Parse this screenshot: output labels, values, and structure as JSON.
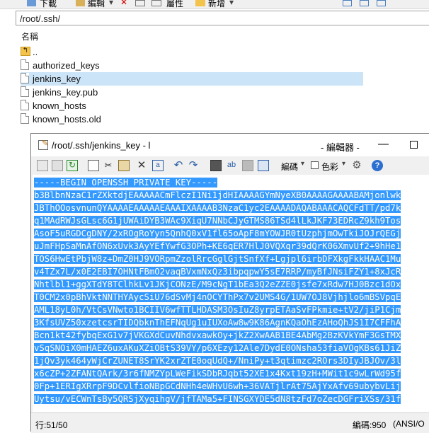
{
  "toolbar": {
    "download_label": "下載",
    "edit_label": "編輯",
    "properties_label": "屬性",
    "new_label": "新增"
  },
  "path_bar": {
    "path": "/root/.ssh/"
  },
  "file_list": {
    "column_name": "名稱",
    "items": [
      {
        "name": "..",
        "type": "parent"
      },
      {
        "name": "authorized_keys",
        "type": "file"
      },
      {
        "name": "jenkins_key",
        "type": "file",
        "selected": true
      },
      {
        "name": "jenkins_key.pub",
        "type": "file"
      },
      {
        "name": "known_hosts",
        "type": "file"
      },
      {
        "name": "known_hosts.old",
        "type": "file"
      }
    ]
  },
  "editor": {
    "title": "/root/.ssh/jenkins_key - l",
    "title_suffix": "- 編輯器 -",
    "toolbar": {
      "encoding_label": "編碼",
      "color_label": "色彩"
    },
    "lines": [
      "-----BEGIN OPENSSH PRIVATE KEY-----",
      "b3BlbnNzaC1rZXktdjEAAAAACmFlczI1Ni1jdHIAAAAGYmNyeXB0AAAAGAAAABAMjonlwk",
      "JBThOOosvnunQYAAAAEAAAAAEAAAIXAAAAB3NzaC1yc2EAAAADAQABAAACAQCFdTT/pd7k",
      "q1MAdRWJsGLsc6G1jUWAiDYB3WAc9XiqU7NNbCJyGTMS86TSd4lLkJKF73EDRcZ9kh9Tos",
      "AsoF5uRGDCgDNY/2xROgRoYyn5QnhQ0xV1fl65oApF8mYOWJR0tUzphjmOwTkiJOJrQEGj",
      "uJmFHpSaMnAfON6xUvk3AyYEfYwfG3OPh+KE6qER7HlJ0VQXqr39dQrK06XmvUf2+9hHe1",
      "TOS6HwEtPbjW8z+DmZ0HJ9VORpmZzolRrcGglGjtSnfXf+Lgjpl6irbDFXkgFkkHAAC1Mu",
      "v4TZx7L/x0E2EBI7OHNtFBmO2vaqBVxmNxQz3ibpqpwY5sE7RRP/myBfJNsiFZY1+8xJcR",
      "Nhtlbl1+ggXTdY8TClhkLv1JKjCONzE/M9cNgT1bEa3Q2eZZE0jsfe7xRdw7HJ0Bzc1dOx",
      "T0CM2x0pBhVktNNTHYAycSiU76dSvMj4nOCYThPx7v2UMS4G/1UW7OJ8Vjhjlo6mBSVpqE",
      "AML18yL0h/VtCsVNwto1BCIIV6wfTTLHDASM3OsIuZ8yrpETAaSvFPkmie+tV2/jiP1Cjm",
      "3KfsUVZ50xzetcsrTIDQbknThEFNqUg1uIUXoAw8w9K86AgnKQaOhEzAHoQhJS1I7CFFhA",
      "Bcn1kt42fybqExG1v7jVKGXdCuvNhdvxawkOy+jkZ2XwAAB1BE4AbMg2BzKVkYmF3GsTMX",
      "vSqSNOiX0mHAEZ6uxAKuXZiOBtS39VY/p6XEzy12Ale7DydE0ONsha53fiaVOgKBs61JiZ",
      "1jQv3yk464yWjCrZUNET8SrYK2xrZTE0oqUdQ+/NniPy+t3qtimzc2ROrs3DIyJBJOv/3l",
      "x6cZP+2ZFANtQArk/3r6fNMZYpLWeFikSDbRJqbt52XE1x4Kxt19zH+MWit1c9wLrWd95f",
      "0Fp+1ERIgXRrpF9DCvlfioNBpGCdNHh4eWHvU6wh+36VATjlrAt75AjYxAfv69ubybvLij",
      "Uytsu/vECWnTsBy5QRSjXyqihgV/jfTAMa5+FINSGXYDE5dN8tzFd7oZecDGFriXSs/31f"
    ],
    "status": {
      "position": "行:51/50",
      "encoding": "編碼:950",
      "ansi": "(ANSI/O"
    }
  }
}
